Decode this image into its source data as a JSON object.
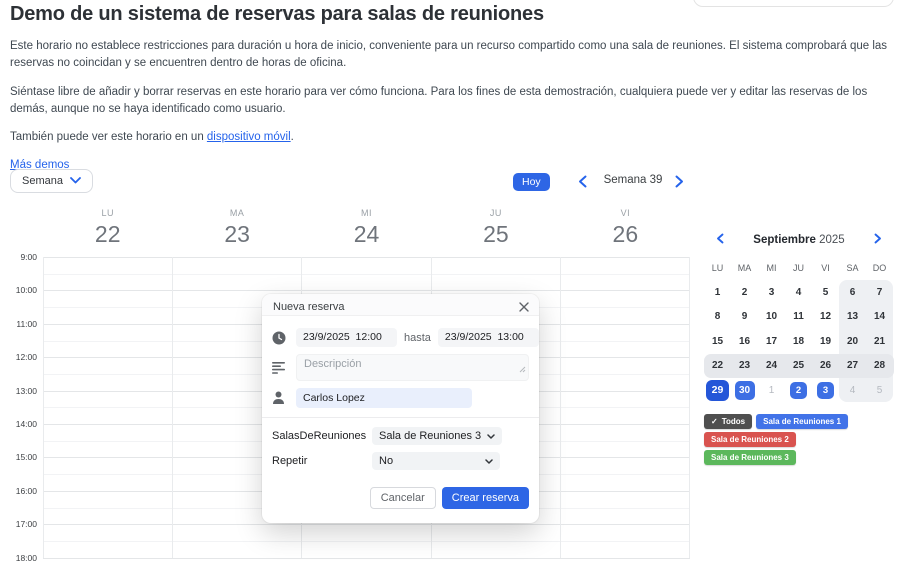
{
  "intro": {
    "title": "Demo de un sistema de reservas para salas de reuniones",
    "paragraphs": [
      "Este horario no establece restricciones para duración u hora de inicio, conveniente para un recurso compartido como una sala de reuniones. El sistema comprobará que las reservas no coincidan y se encuentren dentro de horas de oficina.",
      "Siéntase libre de añadir y borrar reservas en este horario para ver cómo funciona. Para los fines de esta demostración, cualquiera puede ver y editar las reservas de los demás, aunque no se haya identificado como usuario."
    ],
    "mobile_text_before": "También puede ver este horario en un ",
    "mobile_link": "dispositivo móvil",
    "mobile_text_after": ".",
    "more_demos": "Más demos"
  },
  "toolbar": {
    "view_button": "Semana",
    "today_button": "Hoy",
    "range_label": "Semana 39"
  },
  "calendar": {
    "day_names": [
      "LU",
      "MA",
      "MI",
      "JU",
      "VI"
    ],
    "day_numbers": [
      "22",
      "23",
      "24",
      "25",
      "26"
    ],
    "times": [
      "9:00",
      "10:00",
      "11:00",
      "12:00",
      "13:00",
      "14:00",
      "15:00",
      "16:00",
      "17:00",
      "18:00"
    ]
  },
  "modal": {
    "title": "Nueva reserva",
    "start_value": "23/9/2025  12:00",
    "hasta_label": "hasta",
    "end_value": "23/9/2025  13:00",
    "description_placeholder": "Descripción",
    "person_value": "Carlos Lopez",
    "resource_label": "SalasDeReuniones",
    "resource_value": "Sala de Reuniones 3",
    "repeat_label": "Repetir",
    "repeat_value": "No",
    "cancel_button": "Cancelar",
    "create_button": "Crear reserva"
  },
  "mini_calendar": {
    "month": "Septiembre",
    "year": "2025",
    "day_headers": [
      "LU",
      "MA",
      "MI",
      "JU",
      "VI",
      "SA",
      "DO"
    ],
    "weeks": [
      {
        "highlight": false,
        "days": [
          {
            "label": "1",
            "style": "normal"
          },
          {
            "label": "2",
            "style": "normal"
          },
          {
            "label": "3",
            "style": "normal"
          },
          {
            "label": "4",
            "style": "normal"
          },
          {
            "label": "5",
            "style": "normal"
          },
          {
            "label": "6",
            "style": "normal"
          },
          {
            "label": "7",
            "style": "normal"
          }
        ]
      },
      {
        "highlight": false,
        "days": [
          {
            "label": "8",
            "style": "normal"
          },
          {
            "label": "9",
            "style": "normal"
          },
          {
            "label": "10",
            "style": "normal"
          },
          {
            "label": "11",
            "style": "normal"
          },
          {
            "label": "12",
            "style": "normal"
          },
          {
            "label": "13",
            "style": "normal"
          },
          {
            "label": "14",
            "style": "normal"
          }
        ]
      },
      {
        "highlight": false,
        "days": [
          {
            "label": "15",
            "style": "normal"
          },
          {
            "label": "16",
            "style": "normal"
          },
          {
            "label": "17",
            "style": "normal"
          },
          {
            "label": "18",
            "style": "normal"
          },
          {
            "label": "19",
            "style": "normal"
          },
          {
            "label": "20",
            "style": "normal"
          },
          {
            "label": "21",
            "style": "normal"
          }
        ]
      },
      {
        "highlight": true,
        "days": [
          {
            "label": "22",
            "style": "normal"
          },
          {
            "label": "23",
            "style": "normal"
          },
          {
            "label": "24",
            "style": "normal"
          },
          {
            "label": "25",
            "style": "normal"
          },
          {
            "label": "26",
            "style": "normal"
          },
          {
            "label": "27",
            "style": "normal"
          },
          {
            "label": "28",
            "style": "normal"
          }
        ]
      },
      {
        "highlight": false,
        "days": [
          {
            "label": "29",
            "style": "today"
          },
          {
            "label": "30",
            "style": "booked_lg"
          },
          {
            "label": "1",
            "style": "muted"
          },
          {
            "label": "2",
            "style": "booked"
          },
          {
            "label": "3",
            "style": "booked"
          },
          {
            "label": "4",
            "style": "muted"
          },
          {
            "label": "5",
            "style": "muted"
          }
        ]
      }
    ]
  },
  "legend": {
    "check_glyph": "✓",
    "rows": [
      [
        {
          "label": "Todos",
          "color": "#4f4f4f",
          "check": true
        },
        {
          "label": "Sala de Reuniones 1",
          "color": "#4273e8",
          "check": false
        }
      ],
      [
        {
          "label": "Sala de Reuniones 2",
          "color": "#d9534f",
          "check": false
        }
      ],
      [
        {
          "label": "Sala de Reuniones 3",
          "color": "#5cb85c",
          "check": false
        }
      ]
    ]
  },
  "colors": {
    "accent": "#2e66e5",
    "link": "#2563eb"
  }
}
